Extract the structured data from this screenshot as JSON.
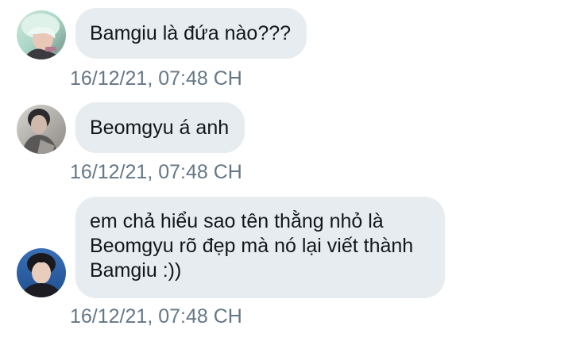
{
  "conversation": {
    "messages": [
      {
        "avatar_icon": "user-avatar-icon",
        "text": "Bamgiu là đứa nào???",
        "timestamp": "16/12/21, 07:48 CH"
      },
      {
        "avatar_icon": "user-avatar-icon",
        "text": "Beomgyu á anh",
        "timestamp": "16/12/21, 07:48 CH"
      },
      {
        "avatar_icon": "user-avatar-icon",
        "text": "em chả hiểu sao tên thằng nhỏ là Beomgyu rõ đẹp mà nó lại viết thành Bamgiu :))",
        "timestamp": "16/12/21, 07:48 CH"
      }
    ]
  },
  "colors": {
    "bubble_background": "#e6ecf0",
    "message_text": "#14171a",
    "timestamp_text": "#657786"
  }
}
